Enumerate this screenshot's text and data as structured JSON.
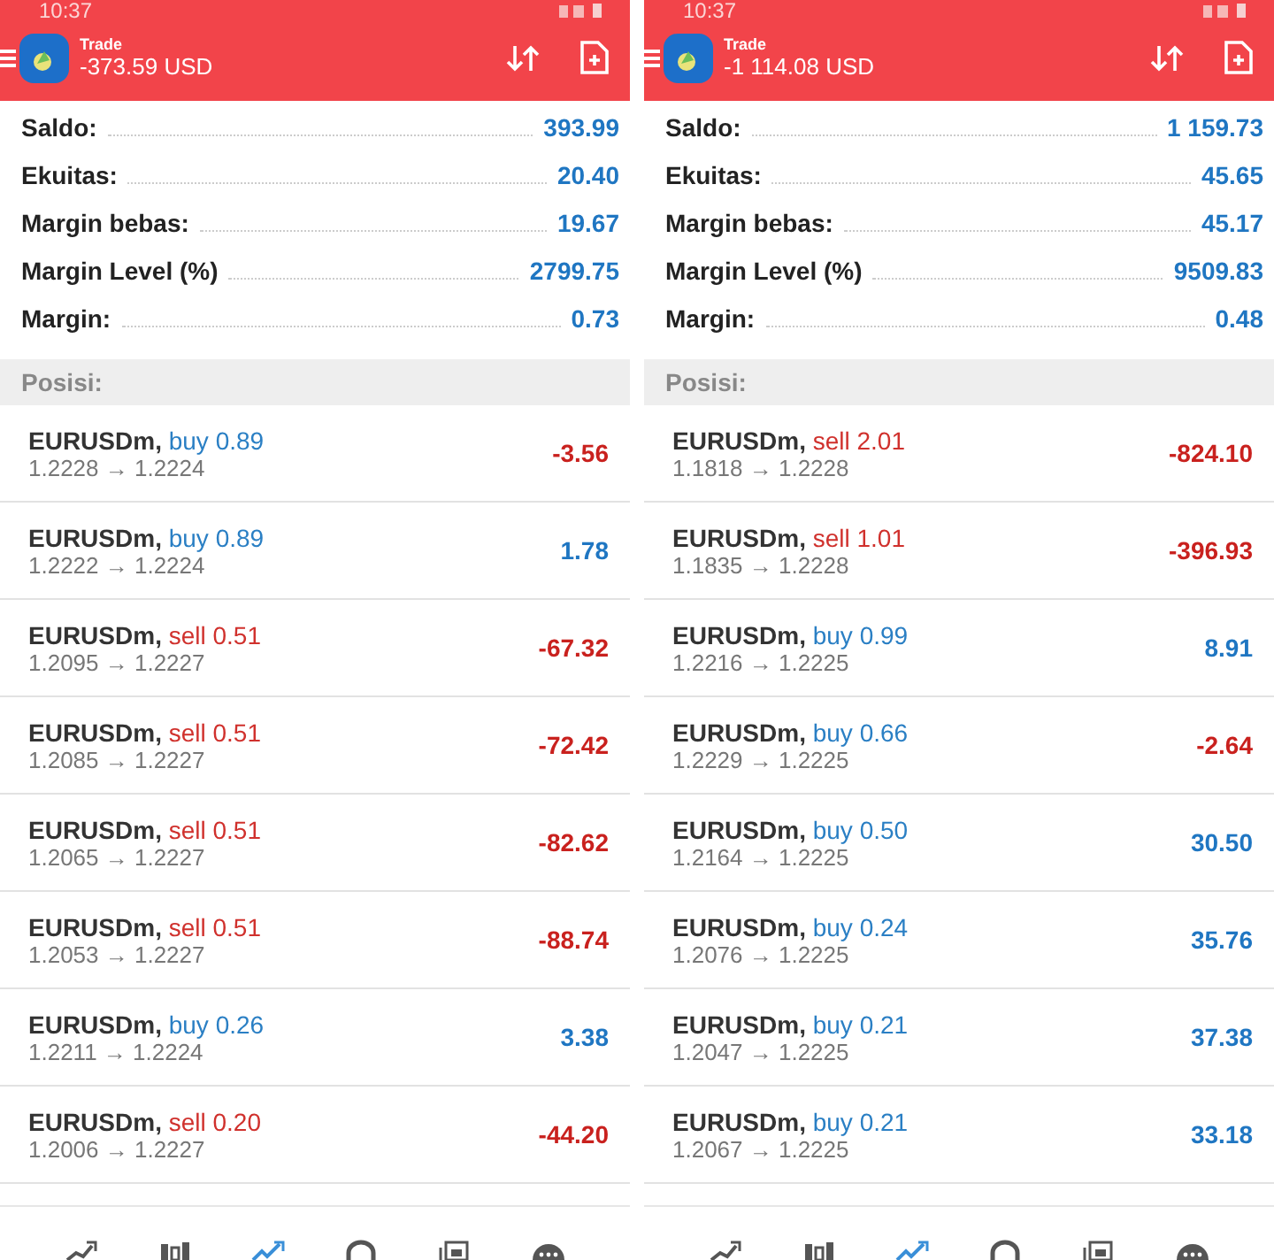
{
  "panels": [
    {
      "status_time": "10:37",
      "header": {
        "title": "Trade",
        "profit": "-373.59 USD"
      },
      "summary": [
        {
          "label": "Saldo:",
          "value": "393.99"
        },
        {
          "label": "Ekuitas:",
          "value": "20.40"
        },
        {
          "label": "Margin bebas:",
          "value": "19.67"
        },
        {
          "label": "Margin Level (%)",
          "value": "2799.75"
        },
        {
          "label": "Margin:",
          "value": "0.73"
        }
      ],
      "section": "Posisi:",
      "positions": [
        {
          "symbol": "EURUSDm,",
          "side": "buy",
          "volume": "0.89",
          "prices": "1.2228 → 1.2224",
          "profit": "-3.56",
          "loss": true
        },
        {
          "symbol": "EURUSDm,",
          "side": "buy",
          "volume": "0.89",
          "prices": "1.2222 → 1.2224",
          "profit": "1.78",
          "loss": false
        },
        {
          "symbol": "EURUSDm,",
          "side": "sell",
          "volume": "0.51",
          "prices": "1.2095 → 1.2227",
          "profit": "-67.32",
          "loss": true
        },
        {
          "symbol": "EURUSDm,",
          "side": "sell",
          "volume": "0.51",
          "prices": "1.2085 → 1.2227",
          "profit": "-72.42",
          "loss": true
        },
        {
          "symbol": "EURUSDm,",
          "side": "sell",
          "volume": "0.51",
          "prices": "1.2065 → 1.2227",
          "profit": "-82.62",
          "loss": true
        },
        {
          "symbol": "EURUSDm,",
          "side": "sell",
          "volume": "0.51",
          "prices": "1.2053 → 1.2227",
          "profit": "-88.74",
          "loss": true
        },
        {
          "symbol": "EURUSDm,",
          "side": "buy",
          "volume": "0.26",
          "prices": "1.2211 → 1.2224",
          "profit": "3.38",
          "loss": false
        },
        {
          "symbol": "EURUSDm,",
          "side": "sell",
          "volume": "0.20",
          "prices": "1.2006 → 1.2227",
          "profit": "-44.20",
          "loss": true
        }
      ],
      "nav": [
        {
          "kind": "quotes",
          "selected": false
        },
        {
          "kind": "chart",
          "selected": false
        },
        {
          "kind": "trade",
          "selected": true
        },
        {
          "kind": "history",
          "selected": false
        },
        {
          "kind": "news",
          "selected": false
        },
        {
          "kind": "chat",
          "selected": false
        }
      ]
    },
    {
      "status_time": "10:37",
      "header": {
        "title": "Trade",
        "profit": "-1 114.08 USD"
      },
      "summary": [
        {
          "label": "Saldo:",
          "value": "1 159.73"
        },
        {
          "label": "Ekuitas:",
          "value": "45.65"
        },
        {
          "label": "Margin bebas:",
          "value": "45.17"
        },
        {
          "label": "Margin Level (%)",
          "value": "9509.83"
        },
        {
          "label": "Margin:",
          "value": "0.48"
        }
      ],
      "section": "Posisi:",
      "positions": [
        {
          "symbol": "EURUSDm,",
          "side": "sell",
          "volume": "2.01",
          "prices": "1.1818 → 1.2228",
          "profit": "-824.10",
          "loss": true
        },
        {
          "symbol": "EURUSDm,",
          "side": "sell",
          "volume": "1.01",
          "prices": "1.1835 → 1.2228",
          "profit": "-396.93",
          "loss": true
        },
        {
          "symbol": "EURUSDm,",
          "side": "buy",
          "volume": "0.99",
          "prices": "1.2216 → 1.2225",
          "profit": "8.91",
          "loss": false
        },
        {
          "symbol": "EURUSDm,",
          "side": "buy",
          "volume": "0.66",
          "prices": "1.2229 → 1.2225",
          "profit": "-2.64",
          "loss": true
        },
        {
          "symbol": "EURUSDm,",
          "side": "buy",
          "volume": "0.50",
          "prices": "1.2164 → 1.2225",
          "profit": "30.50",
          "loss": false
        },
        {
          "symbol": "EURUSDm,",
          "side": "buy",
          "volume": "0.24",
          "prices": "1.2076 → 1.2225",
          "profit": "35.76",
          "loss": false
        },
        {
          "symbol": "EURUSDm,",
          "side": "buy",
          "volume": "0.21",
          "prices": "1.2047 → 1.2225",
          "profit": "37.38",
          "loss": false
        },
        {
          "symbol": "EURUSDm,",
          "side": "buy",
          "volume": "0.21",
          "prices": "1.2067 → 1.2225",
          "profit": "33.18",
          "loss": false
        }
      ],
      "nav": [
        {
          "kind": "quotes",
          "selected": false
        },
        {
          "kind": "chart",
          "selected": false
        },
        {
          "kind": "trade",
          "selected": true
        },
        {
          "kind": "history",
          "selected": false
        },
        {
          "kind": "news",
          "selected": false
        },
        {
          "kind": "chat",
          "selected": false
        }
      ]
    }
  ]
}
